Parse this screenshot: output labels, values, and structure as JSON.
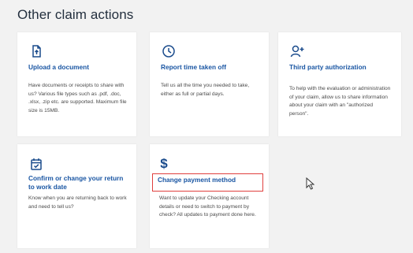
{
  "section": {
    "title": "Other claim actions"
  },
  "cards": [
    {
      "title": "Upload a document",
      "icon": "file-upload-icon",
      "description": "Have documents or receipts to share with us? Various file types such as .pdf, .doc, .xlsx, .zip etc. are supported. Maximum file size is 15MB."
    },
    {
      "title": "Report time taken off",
      "icon": "clock-icon",
      "description": "Tell us all the time you needed to take, either as full or partial days."
    },
    {
      "title": "Third party authorization",
      "icon": "add-person-icon",
      "description": "To help with the evaluation or administration of your claim, allow us to share information about your claim with an \"authorized person\"."
    },
    {
      "title": "Confirm or change your return to work date",
      "icon": "calendar-check-icon",
      "description": "Know when you are returning back to work and need to tell us?"
    },
    {
      "title": "Change payment method",
      "icon": "dollar-icon",
      "description": "Want to update your Checking account details or need to switch to payment by check? All updates to payment done here."
    }
  ],
  "colors": {
    "accent": "#1a56a3",
    "icon": "#1a4b8c",
    "highlight": "#e0403e",
    "background": "#f2f2f2"
  }
}
